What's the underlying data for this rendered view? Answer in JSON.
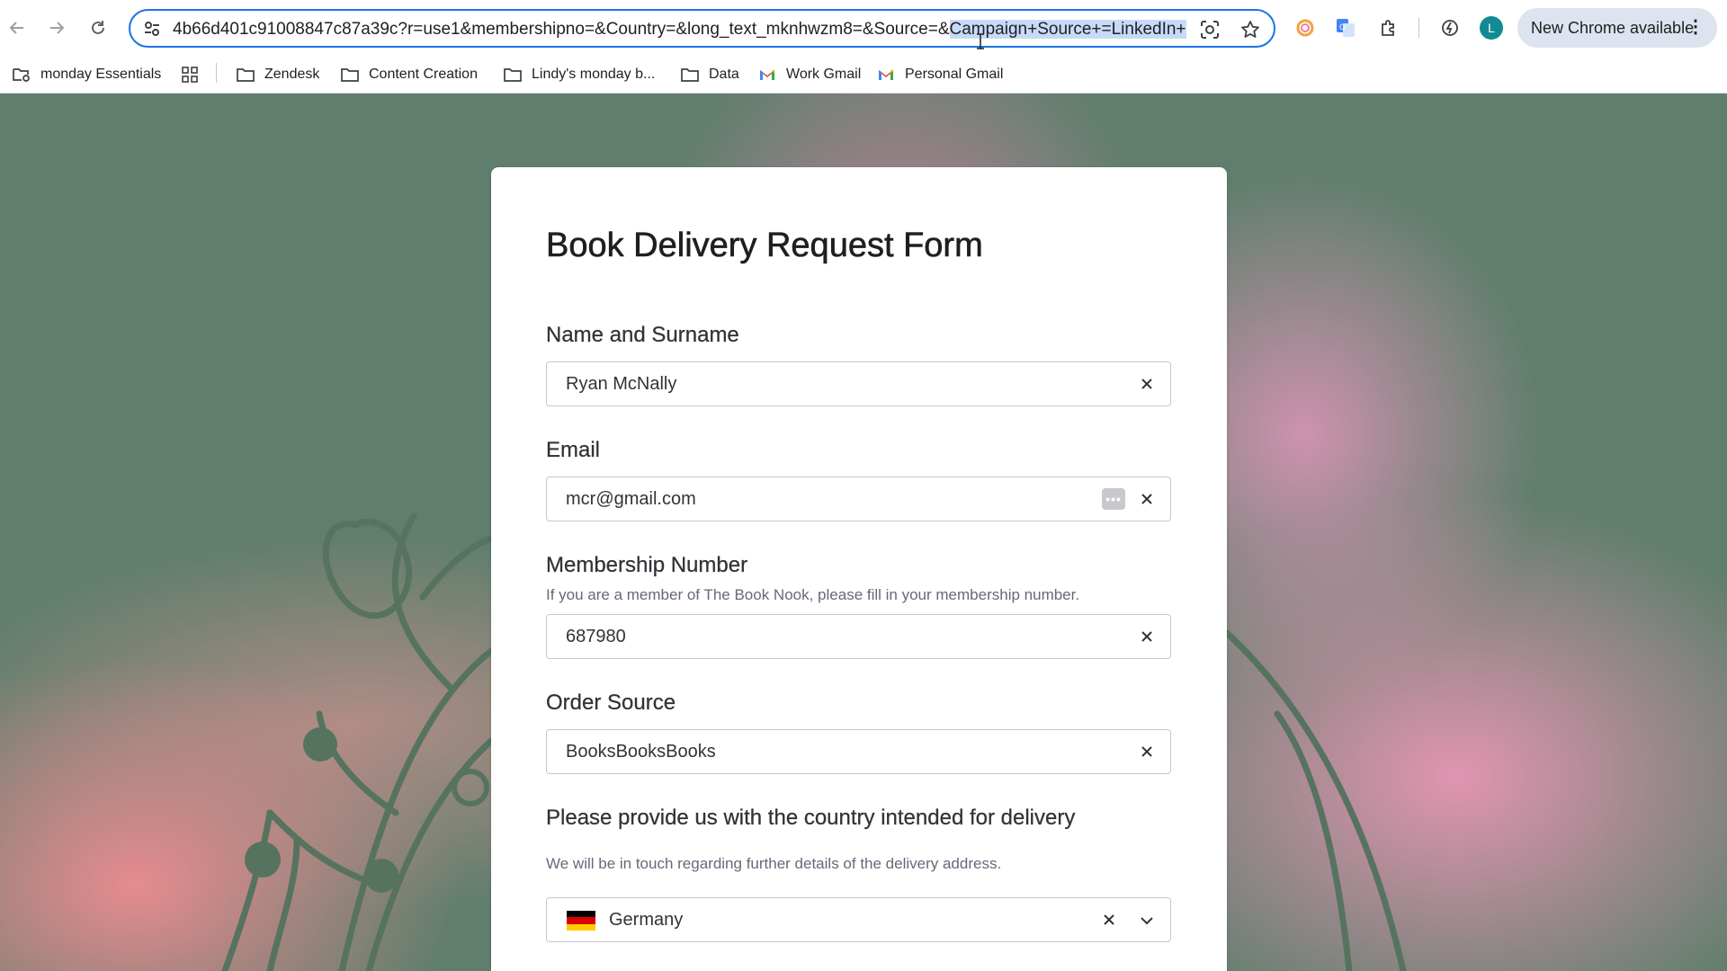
{
  "browser": {
    "url_prefix": "4b66d401c91008847c87a39c?r=use1&membershipno=&Country=&long_text_mknhwzm8=&Source=&",
    "url_selected": "Campaign+Source+=LinkedIn+",
    "avatar_letter": "L",
    "update_label": "New Chrome available",
    "icons": [
      "back-icon",
      "forward-icon",
      "reload-icon",
      "tune-icon",
      "lens-icon",
      "star-icon",
      "circle-extension-icon",
      "translate-icon",
      "puzzle-icon",
      "performance-icon",
      "menu-dots-icon"
    ]
  },
  "bookmarks": [
    {
      "label": "monday Essentials",
      "icon": "folder-gear-icon"
    },
    {
      "label": "",
      "icon": "apps-grid-icon"
    },
    {
      "label": "Zendesk",
      "icon": "folder-icon"
    },
    {
      "label": "Content Creation",
      "icon": "folder-icon"
    },
    {
      "label": "Lindy's monday b...",
      "icon": "folder-icon"
    },
    {
      "label": "Data",
      "icon": "folder-icon"
    },
    {
      "label": "Work Gmail",
      "icon": "gmail-icon"
    },
    {
      "label": "Personal Gmail",
      "icon": "gmail-icon"
    }
  ],
  "form": {
    "title": "Book Delivery Request Form",
    "fields": [
      {
        "label": "Name and Surname",
        "value": "Ryan McNally"
      },
      {
        "label": "Email",
        "value": "mcr@gmail.com"
      },
      {
        "label": "Membership Number",
        "description": "If you are a member of The Book Nook, please fill in your membership number.",
        "value": "687980"
      },
      {
        "label": "Order Source",
        "value": "BooksBooksBooks"
      },
      {
        "label": "Please provide us with the country intended for delivery",
        "description": "We will be in touch regarding further details of the delivery address.",
        "value": "Germany",
        "flag_colors": [
          "#000000",
          "#dd0000",
          "#ffce00"
        ]
      }
    ]
  },
  "colors": {
    "accent": "#1a73e8",
    "page_green": "#5f7e6d",
    "page_pink": "#e896b4"
  }
}
